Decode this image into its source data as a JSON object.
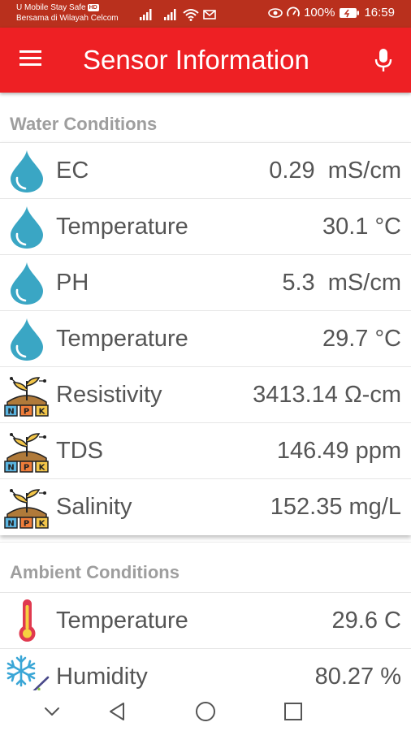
{
  "status_bar": {
    "carrier_line1": "U Mobile Stay Safe",
    "carrier_badge": "HD",
    "carrier_line2": "Bersama di Wilayah Celcom",
    "battery": "100%",
    "time": "16:59"
  },
  "app_bar": {
    "title": "Sensor Information",
    "menu_icon": "hamburger-menu-icon",
    "mic_icon": "microphone-icon",
    "color": "#ee2024"
  },
  "water_conditions": {
    "header": "Water Conditions",
    "rows": [
      {
        "icon": "water-drop-icon",
        "label": "EC",
        "value": "0.29  mS/cm"
      },
      {
        "icon": "water-drop-icon",
        "label": "Temperature",
        "value": "30.1 °C"
      },
      {
        "icon": "water-drop-icon",
        "label": "PH",
        "value": "5.3  mS/cm"
      },
      {
        "icon": "water-drop-icon",
        "label": "Temperature",
        "value": "29.7 °C"
      },
      {
        "icon": "npk-soil-icon",
        "label": "Resistivity",
        "value": "3413.14 Ω-cm"
      },
      {
        "icon": "npk-soil-icon",
        "label": "TDS",
        "value": "146.49 ppm"
      },
      {
        "icon": "npk-soil-icon",
        "label": "Salinity",
        "value": "152.35 mg/L"
      }
    ]
  },
  "ambient_conditions": {
    "header": "Ambient Conditions",
    "rows": [
      {
        "icon": "thermometer-icon",
        "label": "Temperature",
        "value": "29.6 C"
      },
      {
        "icon": "snowflake-humidity-icon",
        "label": "Humidity",
        "value": "80.27 %"
      }
    ]
  },
  "nav_bar": {
    "items": [
      "hide-keyboard-icon",
      "back-icon",
      "home-icon",
      "recents-icon"
    ]
  }
}
